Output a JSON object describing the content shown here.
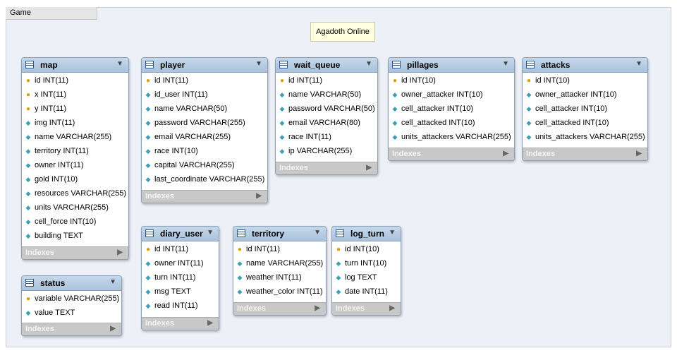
{
  "layer_title": "Game",
  "note": "Agadoth Online",
  "indexes_label": "Indexes",
  "tables": {
    "map": {
      "name": "map",
      "columns": [
        {
          "text": "id INT(11)",
          "key": true
        },
        {
          "text": "x INT(11)",
          "key": true
        },
        {
          "text": "y INT(11)",
          "key": true
        },
        {
          "text": "img INT(11)",
          "key": false
        },
        {
          "text": "name VARCHAR(255)",
          "key": false
        },
        {
          "text": "territory INT(11)",
          "key": false
        },
        {
          "text": "owner INT(11)",
          "key": false
        },
        {
          "text": "gold INT(10)",
          "key": false
        },
        {
          "text": "resources VARCHAR(255)",
          "key": false
        },
        {
          "text": "units VARCHAR(255)",
          "key": false
        },
        {
          "text": "cell_force INT(10)",
          "key": false
        },
        {
          "text": "building TEXT",
          "key": false
        }
      ]
    },
    "player": {
      "name": "player",
      "columns": [
        {
          "text": "id INT(11)",
          "key": true
        },
        {
          "text": "id_user INT(11)",
          "key": false
        },
        {
          "text": "name VARCHAR(50)",
          "key": false
        },
        {
          "text": "password VARCHAR(255)",
          "key": false
        },
        {
          "text": "email VARCHAR(255)",
          "key": false
        },
        {
          "text": "race INT(10)",
          "key": false
        },
        {
          "text": "capital VARCHAR(255)",
          "key": false
        },
        {
          "text": "last_coordinate VARCHAR(255)",
          "key": false
        }
      ]
    },
    "wait_queue": {
      "name": "wait_queue",
      "columns": [
        {
          "text": "id INT(11)",
          "key": true
        },
        {
          "text": "name VARCHAR(50)",
          "key": false
        },
        {
          "text": "password VARCHAR(50)",
          "key": false
        },
        {
          "text": "email VARCHAR(80)",
          "key": false
        },
        {
          "text": "race INT(11)",
          "key": false
        },
        {
          "text": "ip VARCHAR(255)",
          "key": false
        }
      ]
    },
    "pillages": {
      "name": "pillages",
      "columns": [
        {
          "text": "id INT(10)",
          "key": true
        },
        {
          "text": "owner_attacker INT(10)",
          "key": false
        },
        {
          "text": "cell_attacker INT(10)",
          "key": false
        },
        {
          "text": "cell_attacked INT(10)",
          "key": false
        },
        {
          "text": "units_attackers VARCHAR(255)",
          "key": false
        }
      ]
    },
    "attacks": {
      "name": "attacks",
      "columns": [
        {
          "text": "id INT(10)",
          "key": true
        },
        {
          "text": "owner_attacker INT(10)",
          "key": false
        },
        {
          "text": "cell_attacker INT(10)",
          "key": false
        },
        {
          "text": "cell_attacked INT(10)",
          "key": false
        },
        {
          "text": "units_attackers VARCHAR(255)",
          "key": false
        }
      ]
    },
    "status": {
      "name": "status",
      "columns": [
        {
          "text": "variable VARCHAR(255)",
          "key": true
        },
        {
          "text": "value TEXT",
          "key": false
        }
      ]
    },
    "diary_user": {
      "name": "diary_user",
      "columns": [
        {
          "text": "id INT(11)",
          "key": true
        },
        {
          "text": "owner INT(11)",
          "key": false
        },
        {
          "text": "turn INT(11)",
          "key": false
        },
        {
          "text": "msg TEXT",
          "key": false
        },
        {
          "text": "read INT(11)",
          "key": false
        }
      ]
    },
    "territory": {
      "name": "territory",
      "columns": [
        {
          "text": "id INT(11)",
          "key": true
        },
        {
          "text": "name VARCHAR(255)",
          "key": false
        },
        {
          "text": "weather INT(11)",
          "key": false
        },
        {
          "text": "weather_color INT(11)",
          "key": false
        }
      ]
    },
    "log_turn": {
      "name": "log_turn",
      "columns": [
        {
          "text": "id INT(10)",
          "key": true
        },
        {
          "text": "turn INT(10)",
          "key": false
        },
        {
          "text": "log TEXT",
          "key": false
        },
        {
          "text": "date INT(11)",
          "key": false
        }
      ]
    }
  }
}
